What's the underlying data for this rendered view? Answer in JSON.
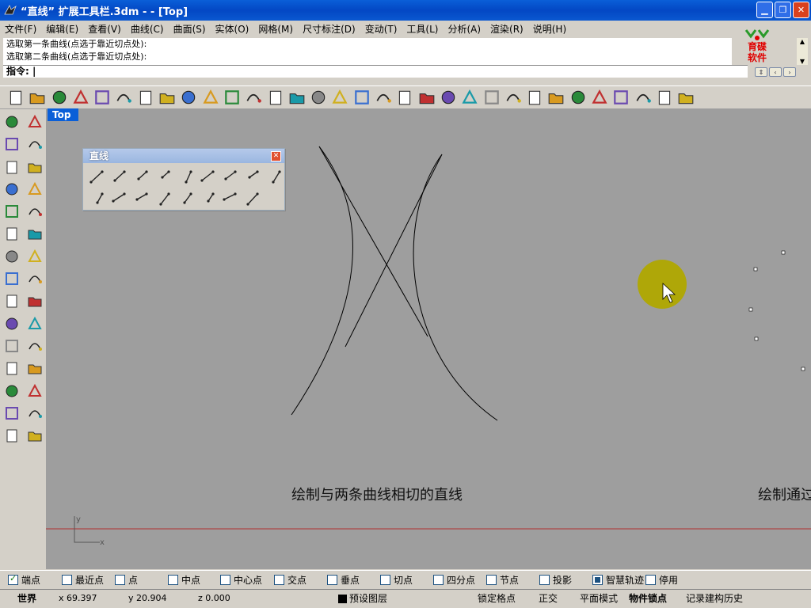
{
  "window": {
    "title": "“直线” 扩展工具栏.3dm -  - [Top]"
  },
  "menu": [
    "文件(F)",
    "编辑(E)",
    "查看(V)",
    "曲线(C)",
    "曲面(S)",
    "实体(O)",
    "网格(M)",
    "尺寸标注(D)",
    "变动(T)",
    "工具(L)",
    "分析(A)",
    "渲染(R)",
    "说明(H)"
  ],
  "command": {
    "history": [
      "选取第一条曲线(点选于靠近切点处):",
      "选取第二条曲线(点选于靠近切点处):"
    ],
    "prompt": "指令:"
  },
  "logo": {
    "line1": "育碟",
    "line2": "软件"
  },
  "toolbar_icons": [
    "new-file-icon",
    "open-folder-icon",
    "save-icon",
    "print-icon",
    "import-icon",
    "cut-icon",
    "copy-icon",
    "paste-icon",
    "undo-icon",
    "pan-hand-icon",
    "rotate-view-icon",
    "zoom-dynamic-icon",
    "zoom-window-icon",
    "zoom-extents-icon",
    "zoom-selected-icon",
    "undo-view-icon",
    "four-viewports-icon",
    "car-icon",
    "cplane-icon",
    "grid-snap-icon",
    "ortho-icon",
    "light-bulb-icon",
    "lock-icon",
    "layer-icon",
    "color-wheel-icon",
    "shaded-sphere-icon",
    "wire-sphere-icon",
    "render-sphere-icon",
    "edit-points-icon",
    "gear-icon",
    "dimension-icon",
    "help-icon"
  ],
  "left_tools": [
    "select-arrow-icon",
    "point-icon",
    "polyline-icon",
    "curve-icon",
    "circle-icon",
    "ellipse-icon",
    "arc-icon",
    "rectangle-icon",
    "polygon-icon",
    "fillet-curve-icon",
    "surface-icon",
    "revolve-icon",
    "box-icon",
    "sphere-group-icon",
    "cylinder-icon",
    "patch-surface-icon",
    "explode-icon",
    "boolean-icon",
    "trim-icon",
    "split-icon",
    "group-icon",
    "ungroup-icon",
    "bend-icon",
    "twist-icon",
    "text-icon",
    "move-icon",
    "array-icon",
    "scale-icon",
    "solid-box-icon",
    "cplane-set-icon"
  ],
  "viewport": {
    "tab_label": "Top",
    "axis_x": "x",
    "axis_y": "y"
  },
  "line_toolbar": {
    "title": "直线",
    "icons": [
      "single-line-icon",
      "polyline-points-icon",
      "line-normal-icon",
      "line-tangent-circle-icon",
      "line-bisector-icon",
      "line-segments-icon",
      "line-angle-icon",
      "line-perpendicular-icon",
      "line-extend-icon",
      "line-short-icon",
      "line-midpoint-icon",
      "line-from-point-icon",
      "line-vertical-icon",
      "line-diagonal-icon",
      "line-tangent-curves-icon",
      "line-angle2-icon",
      "line-sphere-icon"
    ]
  },
  "captions": [
    "绘制与两条曲线相切的直线",
    "绘制通过"
  ],
  "snaps": [
    {
      "label": "端点",
      "checked": true
    },
    {
      "label": "最近点",
      "checked": false
    },
    {
      "label": "点",
      "checked": false
    },
    {
      "label": "中点",
      "checked": false
    },
    {
      "label": "中心点",
      "checked": false
    },
    {
      "label": "交点",
      "checked": false
    },
    {
      "label": "垂点",
      "checked": false
    },
    {
      "label": "切点",
      "checked": false
    },
    {
      "label": "四分点",
      "checked": false
    },
    {
      "label": "节点",
      "checked": false
    },
    {
      "label": "投影",
      "checked": false
    },
    {
      "label": "智慧轨迹",
      "checked": true
    },
    {
      "label": "停用",
      "checked": false
    }
  ],
  "status": {
    "cplane": "世界",
    "x": "x 69.397",
    "y": "y 20.904",
    "z": "z 0.000",
    "layer": "预设图层",
    "grid_snap": "锁定格点",
    "ortho": "正交",
    "planar": "平面模式",
    "osnap": "物件锁点",
    "history": "记录建构历史"
  }
}
